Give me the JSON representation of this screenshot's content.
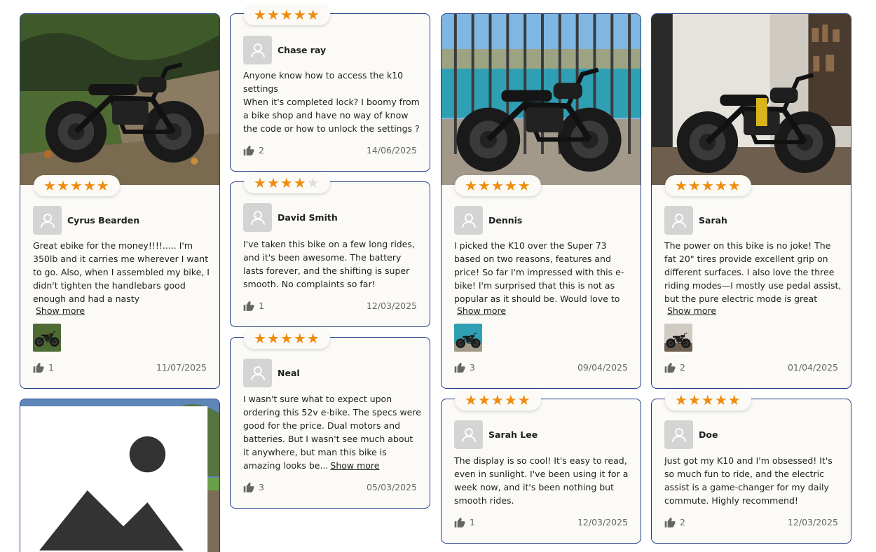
{
  "reviews": [
    {
      "name": "Cyrus Bearden",
      "stars": 5,
      "text": "Great ebike for the money!!!!..... I'm 350lb and it carries me wherever I want to go. Also, when I assembled my bike, I didn't tighten the handlebars good enough and had a nasty spill/crash....this c...",
      "more": "Show more",
      "likes": "1",
      "date": "11/07/2025"
    },
    {
      "name": "Chase ray",
      "stars": 5,
      "text": "Anyone know how to access the k10 settings\nWhen it's completed lock? I boomy from a bike shop and have no way of know the code or how to unlock the settings ?",
      "likes": "2",
      "date": "14/06/2025"
    },
    {
      "name": "David Smith",
      "stars": 4,
      "text": "I've taken this bike on a few long rides, and it's been awesome. The battery lasts forever, and the shifting is super smooth. No complaints so far!",
      "likes": "1",
      "date": "12/03/2025"
    },
    {
      "name": "Neal",
      "stars": 5,
      "text": "I wasn't sure what to expect upon ordering this 52v e-bike. The specs were good for the price. Dual motors and batteries. But I wasn't see much about it anywhere, but man this bike is amazing looks be...",
      "more": "Show more",
      "likes": "3",
      "date": "05/03/2025"
    },
    {
      "name": "Dennis",
      "stars": 5,
      "text": "I picked the K10 over the Super 73 based on two reasons, features and price! So far I'm impressed with this e-bike!  I'm surprised that this is not as popular as it should be. Would love to see afterm...",
      "more": "Show more",
      "likes": "3",
      "date": "09/04/2025"
    },
    {
      "name": "Sarah Lee",
      "stars": 5,
      "text": "The display is so cool! It's easy to read, even in sunlight. I've been using it for a week now, and it's been nothing but smooth rides.",
      "likes": "1",
      "date": "12/03/2025"
    },
    {
      "name": "Sarah",
      "stars": 5,
      "text": "The power on this bike is no joke! The fat 20\" tires provide excellent grip on different surfaces. I also love the three riding modes—I mostly use pedal assist, but the pure electric mode is great whe...",
      "more": "Show more",
      "likes": "2",
      "date": "01/04/2025"
    },
    {
      "name": "Doe",
      "stars": 5,
      "text": "Just got my K10 and I'm obsessed! It's so much fun to ride, and the electric assist is a game-changer for my daily commute. Highly recommend!",
      "likes": "2",
      "date": "12/03/2025"
    }
  ],
  "colors": {
    "star": "#ef8c0e",
    "star_off": "#dedede",
    "border": "#1f3c88"
  },
  "icons": {
    "avatar": "user-icon",
    "like": "thumbs-up-icon",
    "gallery": "gallery-icon"
  }
}
